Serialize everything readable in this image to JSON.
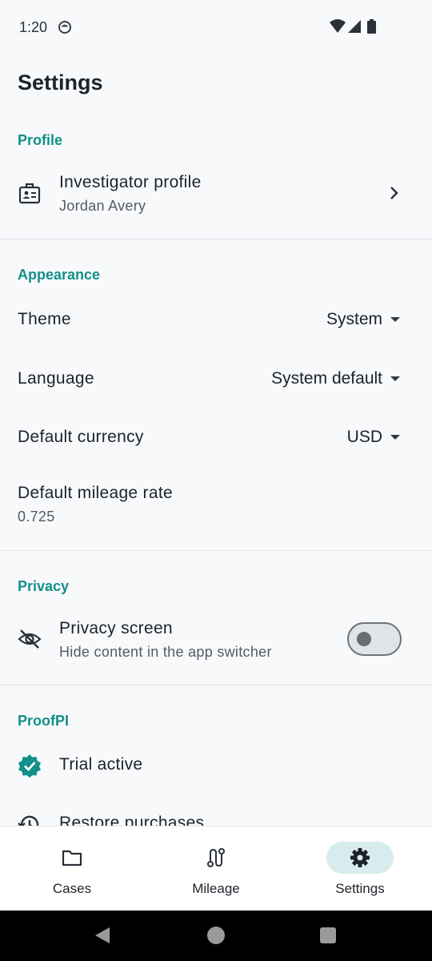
{
  "status_bar": {
    "time": "1:20"
  },
  "page": {
    "title": "Settings"
  },
  "sections": {
    "profile": {
      "header": "Profile",
      "investigator": {
        "title": "Investigator profile",
        "subtitle": "Jordan Avery",
        "icon": "badge-icon"
      }
    },
    "appearance": {
      "header": "Appearance",
      "theme": {
        "label": "Theme",
        "value": "System"
      },
      "language": {
        "label": "Language",
        "value": "System default"
      },
      "currency": {
        "label": "Default currency",
        "value": "USD"
      },
      "mileage": {
        "label": "Default mileage rate",
        "value": "0.725"
      }
    },
    "privacy": {
      "header": "Privacy",
      "privacy_screen": {
        "title": "Privacy screen",
        "subtitle": "Hide content in the app switcher",
        "icon": "eye-off-icon",
        "enabled": false
      }
    },
    "proofpi": {
      "header": "ProofPI",
      "trial": {
        "label": "Trial active",
        "icon": "verified-icon"
      },
      "restore": {
        "label": "Restore purchases",
        "icon": "history-icon"
      }
    }
  },
  "bottom_nav": {
    "items": [
      {
        "label": "Cases",
        "icon": "folder-icon",
        "active": false
      },
      {
        "label": "Mileage",
        "icon": "route-icon",
        "active": false
      },
      {
        "label": "Settings",
        "icon": "gear-icon",
        "active": true
      }
    ]
  },
  "colors": {
    "accent": "#13908a",
    "background": "#f7f9fb",
    "active_pill": "#d7ecec"
  }
}
